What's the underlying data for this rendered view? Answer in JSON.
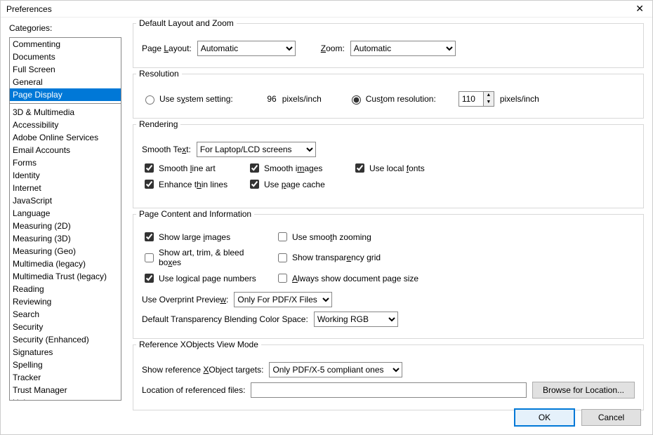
{
  "window": {
    "title": "Preferences"
  },
  "sidebar": {
    "label": "Categories:",
    "groups": [
      [
        "Commenting",
        "Documents",
        "Full Screen",
        "General",
        "Page Display"
      ],
      [
        "3D & Multimedia",
        "Accessibility",
        "Adobe Online Services",
        "Email Accounts",
        "Forms",
        "Identity",
        "Internet",
        "JavaScript",
        "Language",
        "Measuring (2D)",
        "Measuring (3D)",
        "Measuring (Geo)",
        "Multimedia (legacy)",
        "Multimedia Trust (legacy)",
        "Reading",
        "Reviewing",
        "Search",
        "Security",
        "Security (Enhanced)",
        "Signatures",
        "Spelling",
        "Tracker",
        "Trust Manager",
        "Units"
      ]
    ],
    "selected": "Page Display"
  },
  "layoutZoom": {
    "legend": "Default Layout and Zoom",
    "pageLayoutLabelPre": "Page ",
    "pageLayoutLabelU": "L",
    "pageLayoutLabelPost": "ayout:",
    "pageLayout": "Automatic",
    "zoomLabelU": "Z",
    "zoomLabelPost": "oom:",
    "zoom": "Automatic"
  },
  "resolution": {
    "legend": "Resolution",
    "useSystemPre": "Use s",
    "useSystemU": "y",
    "useSystemPost": "stem setting:",
    "systemValue": "96",
    "unit": "pixels/inch",
    "customPre": "Cus",
    "customU": "t",
    "customPost": "om resolution:",
    "customValue": "110"
  },
  "rendering": {
    "legend": "Rendering",
    "smoothTextLabel": "Smooth Te",
    "smoothTextU": "x",
    "smoothTextPost": "t:",
    "smoothText": "For Laptop/LCD screens",
    "lineArtPre": "Smooth ",
    "lineArtU": "l",
    "lineArtPost": "ine art",
    "lineArtChecked": true,
    "imagesPre": "Smooth i",
    "imagesU": "m",
    "imagesPost": "ages",
    "imagesChecked": true,
    "localFontsPre": "Use local ",
    "localFontsU": "f",
    "localFontsPost": "onts",
    "localFontsChecked": true,
    "enhancePre": "Enhance t",
    "enhanceU": "h",
    "enhancePost": "in lines",
    "enhanceChecked": true,
    "pageCachePre": "Use ",
    "pageCacheU": "p",
    "pageCachePost": "age cache",
    "pageCacheChecked": true
  },
  "pageContent": {
    "legend": "Page Content and Information",
    "largeImagesPre": "Show large ",
    "largeImagesU": "i",
    "largeImagesPost": "mages",
    "largeImagesChecked": true,
    "smoothZoomPre": "Use smoo",
    "smoothZoomU": "t",
    "smoothZoomPost": "h zooming",
    "smoothZoomChecked": false,
    "artBoxesPre": "Show art, trim, & bleed bo",
    "artBoxesU": "x",
    "artBoxesPost": "es",
    "artBoxesChecked": false,
    "transGridPre": "Show transpar",
    "transGridU": "e",
    "transGridPost": "ncy grid",
    "transGridChecked": false,
    "logicalPagesPre": "Use lo",
    "logicalPagesU": "g",
    "logicalPagesPost": "ical page numbers",
    "logicalPagesChecked": true,
    "docPageSizePre": "",
    "docPageSizeU": "A",
    "docPageSizePost": "lways show document page size",
    "docPageSizeChecked": false,
    "overprintLabelPre": "Use Overprint Previe",
    "overprintLabelU": "w",
    "overprintLabelPost": ":",
    "overprint": "Only For PDF/X Files",
    "blendingLabel": "Default Transparency Blending Color Space:",
    "blending": "Working RGB"
  },
  "xobjects": {
    "legend": "Reference XObjects View Mode",
    "showRefPre": "Show reference ",
    "showRefU": "X",
    "showRefPost": "Object targets:",
    "showRef": "Only PDF/X-5 compliant ones",
    "locationLabel": "Location of referenced files:",
    "locationValue": "",
    "browse": "Browse for Location..."
  },
  "footer": {
    "ok": "OK",
    "cancel": "Cancel"
  }
}
